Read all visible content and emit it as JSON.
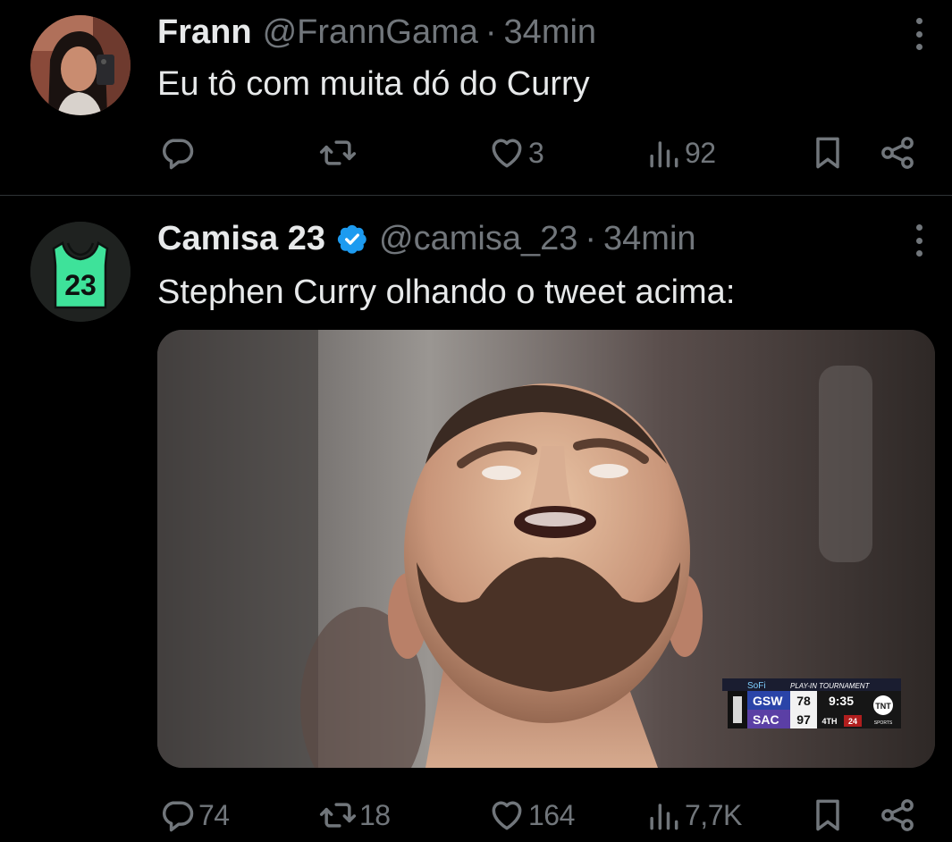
{
  "tweets": [
    {
      "name": "Frann",
      "handle": "@FrannGama",
      "separator": "·",
      "time": "34min",
      "text": "Eu tô com muita dó do Curry",
      "stats": {
        "replies": "",
        "retweets": "",
        "likes": "3",
        "views": "92"
      }
    },
    {
      "name": "Camisa 23",
      "handle": "@camisa_23",
      "separator": "·",
      "time": "34min",
      "verified": true,
      "avatar_number": "23",
      "text": "Stephen Curry olhando o tweet acima:",
      "media": {
        "scorebug": {
          "sponsor": "SoFi",
          "event": "PLAY-IN TOURNAMENT",
          "team1": "GSW",
          "score1": "78",
          "team2": "SAC",
          "score2": "97",
          "clock": "9:35",
          "period": "4TH",
          "shot_clock": "24",
          "network": "TNT",
          "network_sub": "SPORTS"
        }
      },
      "stats": {
        "replies": "74",
        "retweets": "18",
        "likes": "164",
        "views": "7,7K"
      }
    }
  ],
  "colors": {
    "background": "#000000",
    "text": "#e7e9ea",
    "muted": "#71767b",
    "divider": "#2f3336",
    "verified": "#1d9bf0",
    "jersey": "#3ee29a"
  }
}
